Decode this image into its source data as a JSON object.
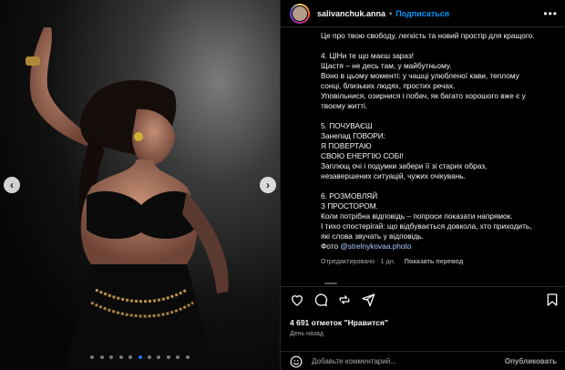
{
  "post": {
    "username": "salivanchuk.anna",
    "separator": "•",
    "follow_label": "Подписаться",
    "more_label": "•••"
  },
  "caption": {
    "intro": "Це про твою свободу, легкість та новий простір для кращого.",
    "s4_title": "4. ЦІНи те що маєш зараз!",
    "s4_l1": "Щастя – не десь там, у майбутньому.",
    "s4_l2": "Воно в цьому моменті: у чашці улюбленої кави, теплому",
    "s4_l3": "сонці, близьких людях, простих речах.",
    "s4_l4": "Уповільнися, озирнися і побач, як багато хорошого вже є у",
    "s4_l5": "твоєму житті.",
    "s5_title": "5. ПОЧУВАЄШ",
    "s5_l1": "Занепад ГОВОРИ:",
    "s5_l2": "Я ПОВЕРТАЮ",
    "s5_l3": "СВОЮ ЕНЕРГІЮ СОБІ!",
    "s5_l4": "Заплющ очі і подумки забери її зі старих образ,",
    "s5_l5": "незавершених ситуацій, чужих очікувань.",
    "s6_title": "6. РОЗМОВЛЯЙ",
    "s6_l1": "З ПРОСТОРОМ.",
    "s6_l2": "Коли потрібна відповідь – попроси показати напрямок.",
    "s6_l3": "І тихо спостерігай: що відбувається довкола, хто приходить,",
    "s6_l4": "які слова звучать у відповідь.",
    "photo_label": "Фото",
    "photo_link": "@strelnykovaa.photo",
    "edited": "Отредактировано",
    "meta_sep": "·",
    "edited_time": "1 дн.",
    "translate": "Показать перевод"
  },
  "stats": {
    "likes": "4 691 отметок \"Нравится\"",
    "posted": "День назад"
  },
  "comment": {
    "placeholder": "Добавьте комментарий...",
    "publish_label": "Опубликовать"
  },
  "carousel": {
    "prev": "‹",
    "next": "›",
    "slide_count": 11,
    "active_index": 5
  },
  "icons": [
    "heart-icon",
    "comment-icon",
    "share-icon",
    "send-icon",
    "bookmark-icon",
    "emoji-icon",
    "more-options-icon"
  ],
  "colors": {
    "accent": "#0095f6",
    "background": "#000000",
    "border": "#262626",
    "muted_text": "#a8a8a8"
  }
}
